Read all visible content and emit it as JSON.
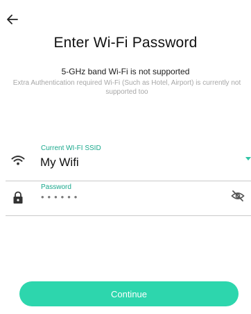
{
  "header": {
    "back_icon": "arrow-left-icon",
    "title": "Enter Wi-Fi Password"
  },
  "notice": {
    "primary": "5-GHz band Wi-Fi is not supported",
    "secondary": "Extra Authentication required Wi-Fi (Such as Hotel, Airport) is currently not supported too"
  },
  "ssid_field": {
    "icon": "wifi-icon",
    "label": "Current WI-FI SSID",
    "value": "My Wifi",
    "dropdown_icon": "caret-down-icon"
  },
  "password_field": {
    "icon": "lock-icon",
    "label": "Password",
    "masked_value": "••••••",
    "visibility_icon": "eye-off-icon"
  },
  "continue_button": {
    "label": "Continue"
  },
  "colors": {
    "accent": "#2dd6ad",
    "label_accent": "#19a88c",
    "muted_text": "#a7a7a7",
    "divider": "#c9c9c9"
  }
}
